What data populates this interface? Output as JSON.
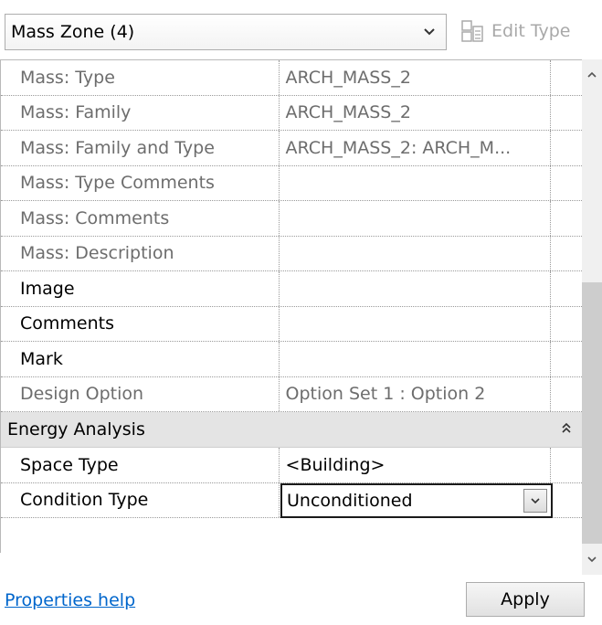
{
  "header": {
    "type_selector_label": "Mass Zone (4)",
    "edit_type_label": "Edit Type"
  },
  "properties": [
    {
      "name": "Mass: Type",
      "value": "ARCH_MASS_2",
      "style": "gray"
    },
    {
      "name": "Mass: Family",
      "value": "ARCH_MASS_2",
      "style": "gray"
    },
    {
      "name": "Mass: Family and Type",
      "value": "ARCH_MASS_2: ARCH_M...",
      "style": "gray"
    },
    {
      "name": "Mass: Type Comments",
      "value": "",
      "style": "gray"
    },
    {
      "name": "Mass: Comments",
      "value": "",
      "style": "gray"
    },
    {
      "name": "Mass: Description",
      "value": "",
      "style": "gray"
    },
    {
      "name": "Image",
      "value": "",
      "style": "normal"
    },
    {
      "name": "Comments",
      "value": "",
      "style": "normal"
    },
    {
      "name": "Mark",
      "value": "",
      "style": "normal"
    },
    {
      "name": "Design Option",
      "value": "Option Set 1 : Option 2",
      "style": "gray"
    }
  ],
  "energy_group": {
    "label": "Energy Analysis",
    "rows": [
      {
        "name": "Space Type",
        "value": "<Building>"
      },
      {
        "name": "Condition Type",
        "value": "Unconditioned"
      }
    ]
  },
  "footer": {
    "help_link": "Properties help",
    "apply_label": "Apply"
  }
}
